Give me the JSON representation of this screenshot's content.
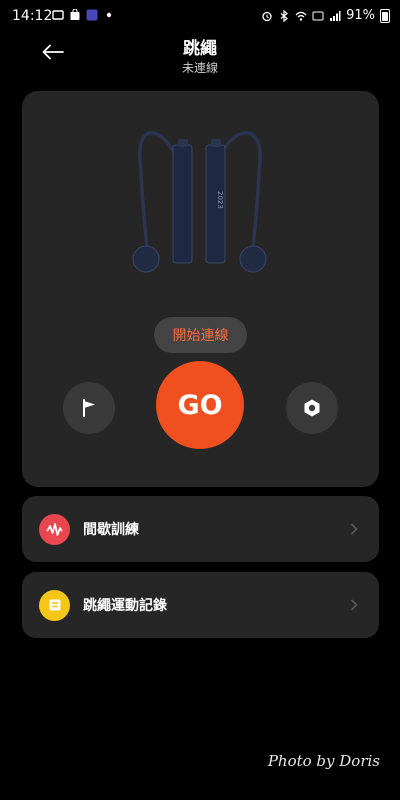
{
  "status_bar": {
    "time": "14:12",
    "battery": "91%"
  },
  "header": {
    "title": "跳繩",
    "subtitle": "未連線",
    "back_icon": "arrow-left-icon"
  },
  "main_card": {
    "connect_label": "開始連線",
    "go_label": "GO",
    "flag_icon": "flag-icon",
    "settings_icon": "hex-settings-icon"
  },
  "menu": {
    "items": [
      {
        "label": "間歇訓練",
        "icon": "waveform-icon",
        "icon_color": "#e8474f"
      },
      {
        "label": "跳繩運動記錄",
        "icon": "record-icon",
        "icon_color": "#f5c518"
      }
    ]
  },
  "colors": {
    "accent": "#f0501f",
    "connect_text": "#ff6a3c",
    "card": "#262626",
    "background": "#000000"
  },
  "watermark": "Photo by Doris"
}
